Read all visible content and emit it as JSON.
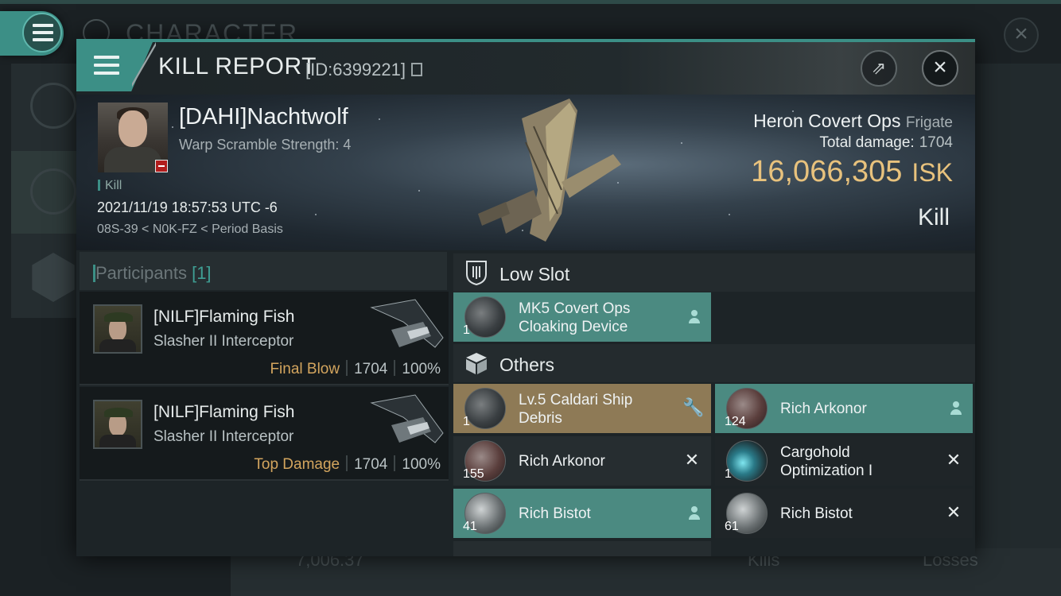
{
  "background": {
    "title": "CHARACTER",
    "bottom_value": "7,006.37",
    "bottom_kills": "Kills",
    "bottom_losses": "Losses"
  },
  "dialog": {
    "title": "KILL REPORT",
    "id_label": "[ID:6399221]"
  },
  "victim": {
    "name": "[DAHI]Nachtwolf",
    "warp_scramble": "Warp Scramble Strength: 4",
    "kill_tag": "Kill",
    "timestamp": "2021/11/19 18:57:53 UTC -6",
    "location": "08S-39 < N0K-FZ < Period Basis",
    "ship_name": "Heron Covert Ops",
    "ship_class": "Frigate",
    "total_damage_label": "Total damage:",
    "total_damage_value": "1704",
    "isk_value": "16,066,305",
    "isk_unit": "ISK",
    "result": "Kill"
  },
  "participants": {
    "title": "Participants",
    "count": "[1]",
    "rows": [
      {
        "name": "[NILF]Flaming Fish",
        "ship": "Slasher II Interceptor",
        "tag": "Final Blow",
        "damage": "1704",
        "percent": "100%"
      },
      {
        "name": "[NILF]Flaming Fish",
        "ship": "Slasher II Interceptor",
        "tag": "Top Damage",
        "damage": "1704",
        "percent": "100%"
      }
    ]
  },
  "items": {
    "low_slot_title": "Low Slot",
    "others_title": "Others",
    "low_slot": [
      {
        "qty": "1",
        "line1": "MK5 Covert Ops",
        "line2": "Cloaking Device",
        "action": "person-icon",
        "state": "dropped"
      }
    ],
    "others": [
      {
        "qty": "1",
        "line1": "Lv.5 Caldari Ship",
        "line2": "Debris",
        "action": "wrench-icon",
        "state": "special"
      },
      {
        "qty": "124",
        "line1": "Rich Arkonor",
        "line2": "",
        "action": "person-icon",
        "state": "dropped"
      },
      {
        "qty": "155",
        "line1": "Rich Arkonor",
        "line2": "",
        "action": "x-icon",
        "state": "destroyed"
      },
      {
        "qty": "1",
        "line1": "Cargohold",
        "line2": "Optimization I",
        "action": "x-icon",
        "state": "destroyed"
      },
      {
        "qty": "41",
        "line1": "Rich Bistot",
        "line2": "",
        "action": "person-icon",
        "state": "dropped"
      },
      {
        "qty": "61",
        "line1": "Rich Bistot",
        "line2": "",
        "action": "x-icon",
        "state": "destroyed"
      }
    ]
  },
  "colors": {
    "accent": "#3c8f86",
    "isk": "#e8c27d",
    "dropped": "#4b8a81",
    "special": "#8e7a56",
    "tag": "#d3a55e"
  }
}
